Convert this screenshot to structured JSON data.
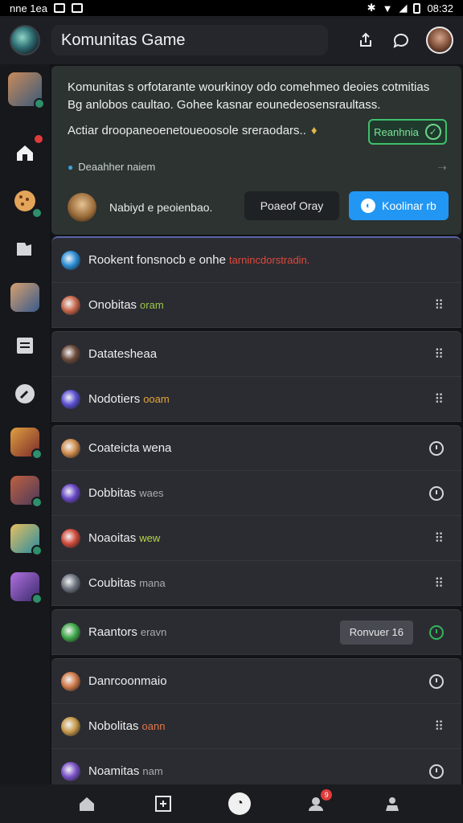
{
  "statusbar": {
    "left_text": "nne 1ea",
    "time": "08:32"
  },
  "header": {
    "title": "Komunitas Game"
  },
  "hero": {
    "text": "Komunitas s orfotarante wourkinoy odo comehmeo deoies cotmitias Bg anlobos caultao. Gohee kasnar eounedeosensraultass.",
    "subtitle": "Actiar droopaneoenetoueoosole sreraodars..",
    "tag_label": "Reanhnia",
    "link_label": "Deaahher naiem",
    "person_label": "Nabiyd e peoienbao.",
    "button_secondary": "Poaeof Oray",
    "button_primary": "Koolinar rb"
  },
  "rows": [
    {
      "label": "Rookent fonsnocb e onhe",
      "suffix": "tarnincdorstradin.",
      "suffix_color": "#e0483c",
      "icon_color": "#2b8fd8",
      "right": "none",
      "card": "top"
    },
    {
      "label": "Onobitas",
      "suffix": "oram",
      "suffix_color": "#9bc64c",
      "icon_color": "#c8664a",
      "right": "dots",
      "card": "same"
    },
    {
      "label": "Datatesheaa",
      "suffix": "",
      "suffix_color": "#9bc64c",
      "icon_color": "#6a4a3a",
      "right": "dots",
      "card": "gap"
    },
    {
      "label": "Nodotiers",
      "suffix": "ooam",
      "suffix_color": "#e5a53a",
      "icon_color": "#5a4fd0",
      "right": "dots",
      "card": "same"
    },
    {
      "label": "Coateicta wena",
      "suffix": "",
      "suffix_color": "#9bc64c",
      "icon_color": "#d08b4b",
      "right": "clock",
      "card": "gap"
    },
    {
      "label": "Dobbitas",
      "suffix": "waes",
      "suffix_color": "#a8aab0",
      "icon_color": "#6a48c8",
      "right": "clock",
      "card": "same"
    },
    {
      "label": "Noaoitas",
      "suffix": "wew",
      "suffix_color": "#b7d84a",
      "icon_color": "#d04a3a",
      "right": "dots",
      "card": "same"
    },
    {
      "label": "Coubitas",
      "suffix": "mana",
      "suffix_color": "#a8aab0",
      "icon_color": "#6f7682",
      "right": "dots",
      "card": "same"
    },
    {
      "label": "Raantors",
      "suffix": "eravn",
      "suffix_color": "#a8aab0",
      "icon_color": "#3faa4a",
      "right": "pill",
      "pill_label": "Ronvuer 16",
      "card": "gap"
    },
    {
      "label": "Danrcoonmaio",
      "suffix": "",
      "suffix_color": "#a8aab0",
      "icon_color": "#d07a4a",
      "right": "clock",
      "card": "gap"
    },
    {
      "label": "Nobolitas",
      "suffix": "oann",
      "suffix_color": "#e0784a",
      "icon_color": "#c89a4a",
      "right": "dots",
      "card": "same"
    },
    {
      "label": "Noamitas",
      "suffix": "nam",
      "suffix_color": "#a8aab0",
      "icon_color": "#7a52c8",
      "right": "clock",
      "card": "same"
    }
  ],
  "rail": [
    {
      "name": "rail-avatar-top",
      "colors": [
        "#c98a5a",
        "#3a5a7a"
      ],
      "status": "dot"
    },
    {
      "name": "rail-home",
      "glyph": "home-icon",
      "badge": true
    },
    {
      "name": "rail-cookie",
      "glyph": "cookie-icon",
      "status": "dot"
    },
    {
      "name": "rail-puzzle",
      "glyph": "puzzle-icon"
    },
    {
      "name": "rail-avatar-2",
      "colors": [
        "#d6a070",
        "#3a5a8a"
      ]
    },
    {
      "name": "rail-calendar",
      "glyph": "calendar-icon"
    },
    {
      "name": "rail-wrench",
      "glyph": "wrench-icon"
    },
    {
      "name": "rail-avatar-3",
      "colors": [
        "#e0a040",
        "#7a2a2a"
      ],
      "status": "dot"
    },
    {
      "name": "rail-avatar-4",
      "colors": [
        "#c06040",
        "#4a3a5a"
      ],
      "status": "dot"
    },
    {
      "name": "rail-avatar-5",
      "colors": [
        "#e6c060",
        "#2a8aa0"
      ],
      "status": "dot"
    },
    {
      "name": "rail-avatar-6",
      "colors": [
        "#b070e0",
        "#3a2a6a"
      ],
      "status": "dot"
    }
  ],
  "bottom_nav": {
    "notification_count": "9"
  },
  "colors": {
    "accent": "#2196f3",
    "success": "#3fbf6c",
    "danger": "#e03b3b"
  }
}
